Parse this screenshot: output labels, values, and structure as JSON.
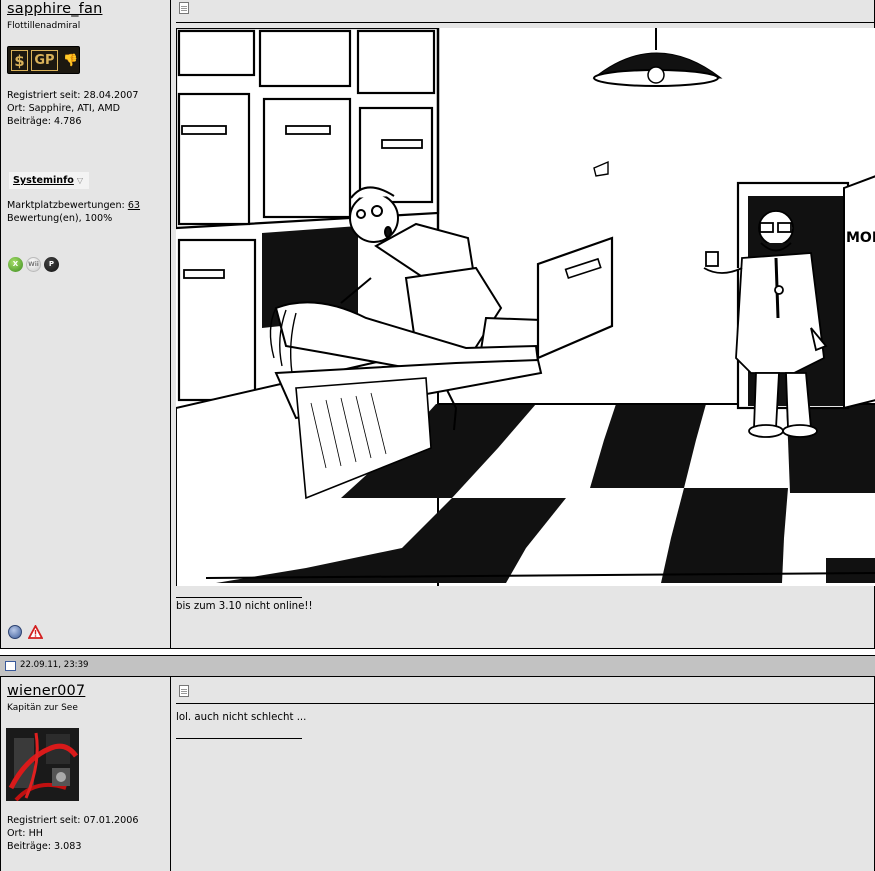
{
  "posts": [
    {
      "author": {
        "username": "sapphire_fan",
        "rank": "Flottillenadmiral",
        "badge": {
          "dollar": "$",
          "letters": "GP",
          "thumb": "👎"
        },
        "registered_label": "Registriert seit:",
        "registered": "28.04.2007",
        "location_label": "Ort:",
        "location": "Sapphire, ATI, AMD",
        "posts_label": "Beiträge:",
        "posts": "4.786",
        "systeminfo_label": "Systeminfo",
        "marketplace_label": "Marktplatzbewertungen:",
        "marketplace_count": "63",
        "rating_text": "Bewertung(en), 100%",
        "console_icons": [
          "xbox-icon",
          "wii-icon",
          "playstation-icon"
        ],
        "bottom_icons": [
          "globe-icon",
          "report-warning-icon"
        ]
      },
      "content": {
        "image_description": "comic",
        "image_sign_text": "MOR",
        "message": "bis zum 3.10 nicht online!!"
      }
    },
    {
      "timestamp": "22.09.11, 23:39",
      "author": {
        "username": "wiener007",
        "rank": "Kapitän zur See",
        "registered_label": "Registriert seit:",
        "registered": "07.01.2006",
        "location_label": "Ort:",
        "location": "HH",
        "posts_label": "Beiträge:",
        "posts": "3.083"
      },
      "content": {
        "message": "lol. auch nicht schlecht ..."
      }
    }
  ],
  "colors": {
    "panel_bg": "#e5e5e5",
    "datebar_bg": "#c2c2c2",
    "badge_gold": "#d9b25a"
  }
}
